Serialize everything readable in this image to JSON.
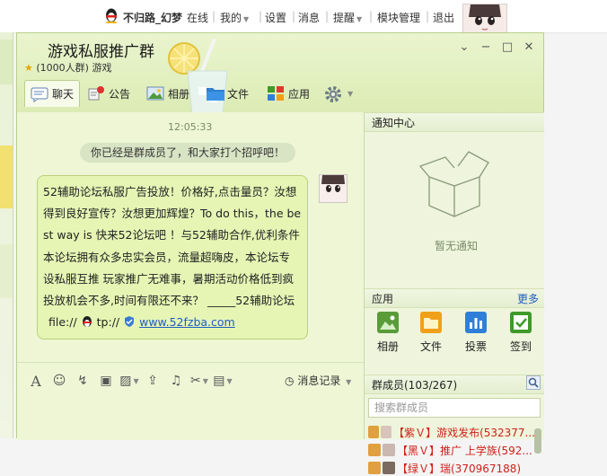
{
  "topbar": {
    "username": "不归路_幻梦",
    "status": "在线",
    "links": [
      "我的",
      "设置",
      "消息",
      "提醒",
      "模块管理",
      "退出"
    ]
  },
  "group": {
    "title": "游戏私服推广群",
    "size_label": "(1000人群)",
    "category": "游戏"
  },
  "tabs": [
    {
      "label": "聊天",
      "icon": "chat-icon",
      "active": true
    },
    {
      "label": "公告",
      "icon": "announcement-icon"
    },
    {
      "label": "相册",
      "icon": "album-icon"
    },
    {
      "label": "文件",
      "icon": "folder-icon"
    },
    {
      "label": "应用",
      "icon": "apps-icon"
    }
  ],
  "chat": {
    "timestamp": "12:05:33",
    "system_message": "你已经是群成员了，和大家打个招呼吧！",
    "message_lines": [
      "52辅助论坛私服广告投放！价格好,点击量员？汝想",
      "得到良好宣传？汝想更加辉煌？To do this，the be",
      "st way is 快来52论坛吧 ！与52辅助合作,优利条件",
      "本论坛拥有众多忠实会员，流量超嗨皮，本论坛专",
      "设私服互推 玩家推广无难事，暑期活动价格低到疯",
      "投放机会不多,时间有限还不来？ _____52辅助论坛"
    ],
    "message_link_prefix": "file://",
    "message_link_mid": "tp://",
    "message_url": "www.52fzba.com",
    "history_label": "消息记录"
  },
  "notice": {
    "header": "通知中心",
    "empty_text": "暂无通知"
  },
  "apps": {
    "header": "应用",
    "more": "更多",
    "items": [
      {
        "label": "相册",
        "icon": "album-icon",
        "color": "#5a9b3a"
      },
      {
        "label": "文件",
        "icon": "folder-icon",
        "color": "#f0a018"
      },
      {
        "label": "投票",
        "icon": "vote-icon",
        "color": "#2f7fd8"
      },
      {
        "label": "签到",
        "icon": "checkin-icon",
        "color": "#3f9a2a"
      }
    ]
  },
  "members": {
    "header": "群成员(103/267)",
    "search_placeholder": "搜索群成员",
    "list": [
      "【紫Ｖ】游戏发布(532377...",
      "【黑Ｖ】推广 上学族(592...",
      "【绿Ｖ】瑞(370967188)"
    ]
  }
}
